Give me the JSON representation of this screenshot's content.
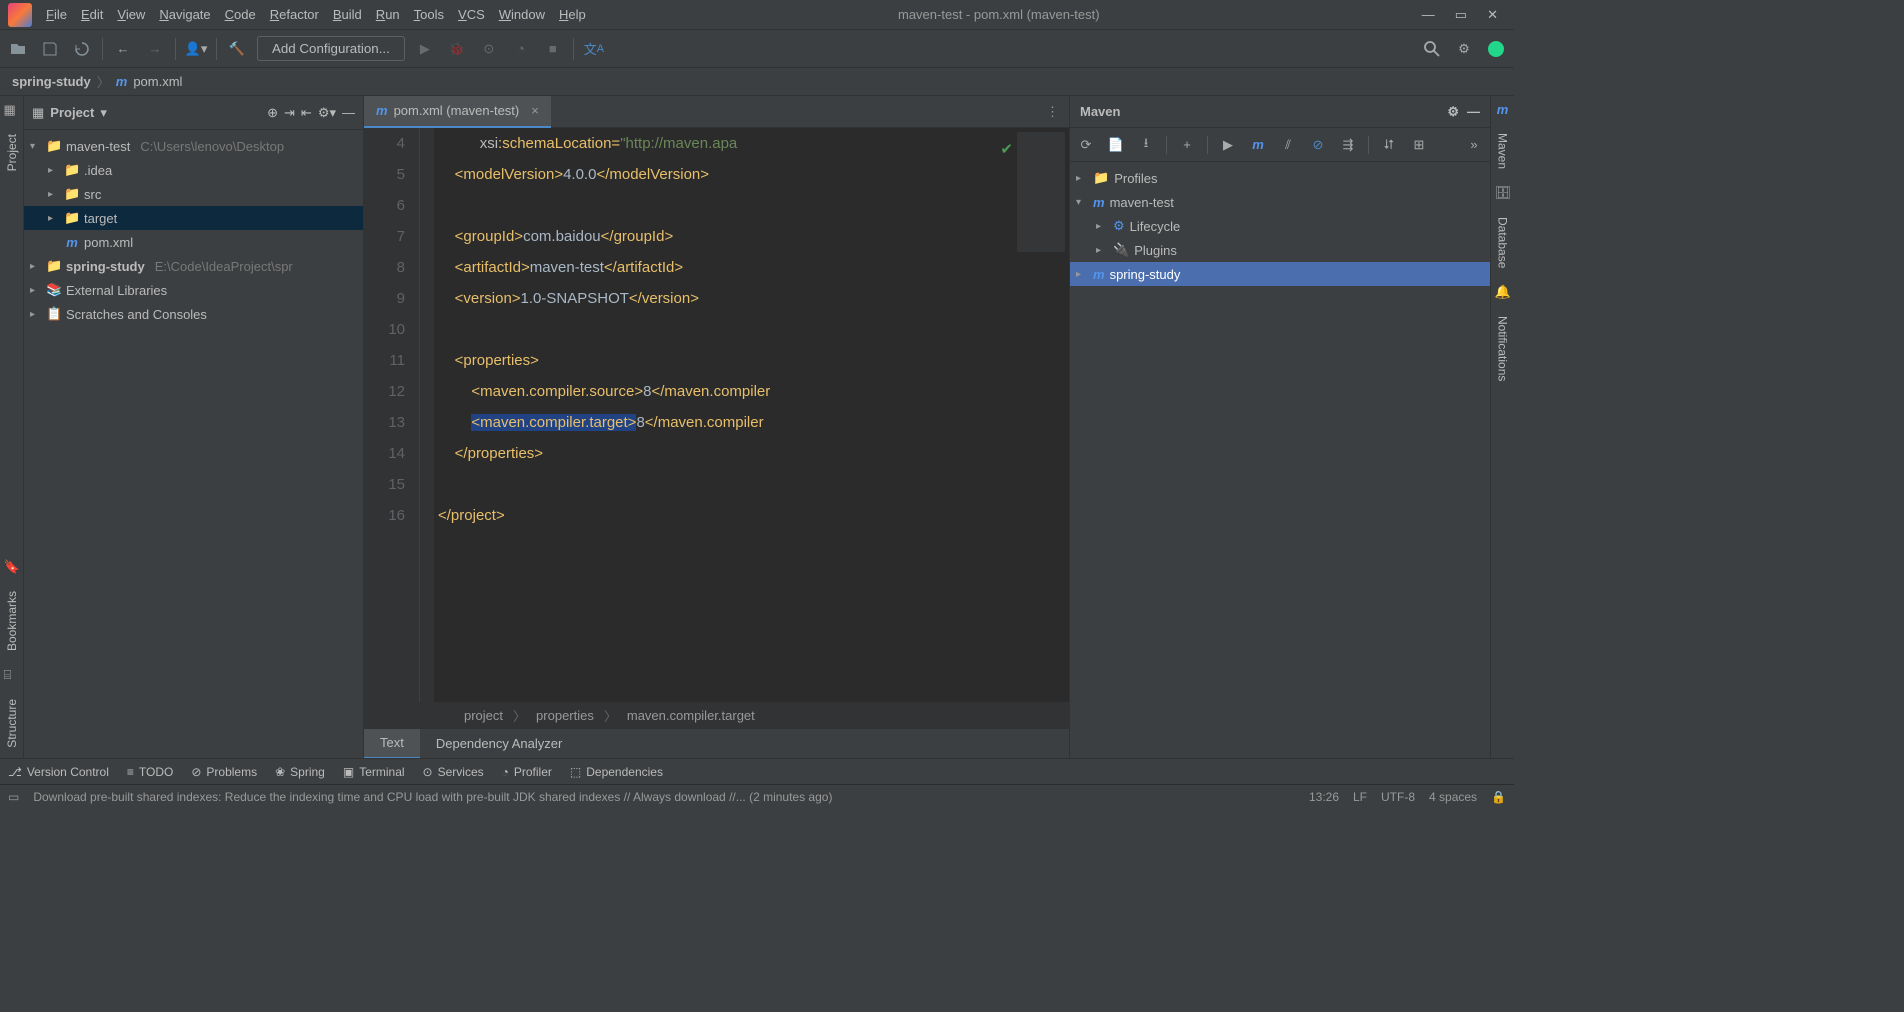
{
  "title": "maven-test - pom.xml (maven-test)",
  "menus": [
    "File",
    "Edit",
    "View",
    "Navigate",
    "Code",
    "Refactor",
    "Build",
    "Run",
    "Tools",
    "VCS",
    "Window",
    "Help"
  ],
  "addconfig": "Add Configuration...",
  "nav": {
    "root": "spring-study",
    "file": "pom.xml"
  },
  "project": {
    "label": "Project",
    "tree": [
      {
        "d": 0,
        "arrow": "▾",
        "icon": "folder",
        "cls": "folder-gray",
        "name": "maven-test",
        "dim": "C:\\Users\\lenovo\\Desktop"
      },
      {
        "d": 1,
        "arrow": "▸",
        "icon": "folder",
        "cls": "folder-gray",
        "name": ".idea"
      },
      {
        "d": 1,
        "arrow": "▸",
        "icon": "folder",
        "cls": "folder-gray",
        "name": "src"
      },
      {
        "d": 1,
        "arrow": "▸",
        "icon": "folder",
        "cls": "folder-orange",
        "name": "target",
        "sel": true
      },
      {
        "d": 1,
        "arrow": "",
        "icon": "m",
        "cls": "m-icon",
        "name": "pom.xml"
      },
      {
        "d": 0,
        "arrow": "▸",
        "icon": "folder",
        "cls": "folder-gray",
        "name": "spring-study",
        "dim": "E:\\Code\\IdeaProject\\spr",
        "bold": true
      },
      {
        "d": 0,
        "arrow": "▸",
        "icon": "lib",
        "cls": "",
        "name": "External Libraries"
      },
      {
        "d": 0,
        "arrow": "▸",
        "icon": "scratch",
        "cls": "",
        "name": "Scratches and Consoles"
      }
    ]
  },
  "tab": {
    "label": "pom.xml (maven-test)"
  },
  "code": {
    "start": 4,
    "lines": [
      {
        "html": "          <span class='a'>xsi</span><span class='t'>:schemaLocation=</span><span class='s'>\"http://maven.apa</span>"
      },
      {
        "html": "    <span class='t'>&lt;modelVersion&gt;</span><span class='v'>4.0.0</span><span class='t'>&lt;/modelVersion&gt;</span>"
      },
      {
        "html": " "
      },
      {
        "html": "    <span class='t'>&lt;groupId&gt;</span><span class='v'>com.baidou</span><span class='t'>&lt;/groupId&gt;</span>"
      },
      {
        "html": "    <span class='t'>&lt;artifactId&gt;</span><span class='v'>maven-test</span><span class='t'>&lt;/artifactId&gt;</span>"
      },
      {
        "html": "    <span class='t'>&lt;version&gt;</span><span class='v'>1.0-SNAPSHOT</span><span class='t'>&lt;/version&gt;</span>"
      },
      {
        "html": " "
      },
      {
        "html": "    <span class='t'>&lt;properties&gt;</span>"
      },
      {
        "html": "        <span class='t'>&lt;maven.compiler.source&gt;</span><span class='v'>8</span><span class='t'>&lt;/maven.compiler</span>"
      },
      {
        "html": "        <span class='t hl'>&lt;maven.compiler.target&gt;</span><span class='v'>8</span><span class='t'>&lt;/maven.compiler</span>"
      },
      {
        "html": "    <span class='t'>&lt;/properties&gt;</span>"
      },
      {
        "html": " "
      },
      {
        "html": "<span class='t'>&lt;/project&gt;</span>"
      }
    ]
  },
  "breadcrumb": [
    "project",
    "properties",
    "maven.compiler.target"
  ],
  "bottabs": [
    "Text",
    "Dependency Analyzer"
  ],
  "maven": {
    "label": "Maven",
    "tree": [
      {
        "d": 0,
        "arrow": "▸",
        "icon": "profiles",
        "name": "Profiles"
      },
      {
        "d": 0,
        "arrow": "▾",
        "icon": "m",
        "name": "maven-test"
      },
      {
        "d": 1,
        "arrow": "▸",
        "icon": "cycle",
        "name": "Lifecycle"
      },
      {
        "d": 1,
        "arrow": "▸",
        "icon": "plug",
        "name": "Plugins"
      },
      {
        "d": 0,
        "arrow": "▸",
        "icon": "m",
        "name": "spring-study",
        "sel": true
      }
    ]
  },
  "leftgutter": [
    "Project",
    "Bookmarks",
    "Structure"
  ],
  "rightgutter": [
    "Maven",
    "Database",
    "Notifications"
  ],
  "bottombar": [
    "Version Control",
    "TODO",
    "Problems",
    "Spring",
    "Terminal",
    "Services",
    "Profiler",
    "Dependencies"
  ],
  "status": {
    "msg": "Download pre-built shared indexes: Reduce the indexing time and CPU load with pre-built JDK shared indexes // Always download //... (2 minutes ago)",
    "time": "13:26",
    "lf": "LF",
    "enc": "UTF-8",
    "spaces": "4 spaces"
  }
}
